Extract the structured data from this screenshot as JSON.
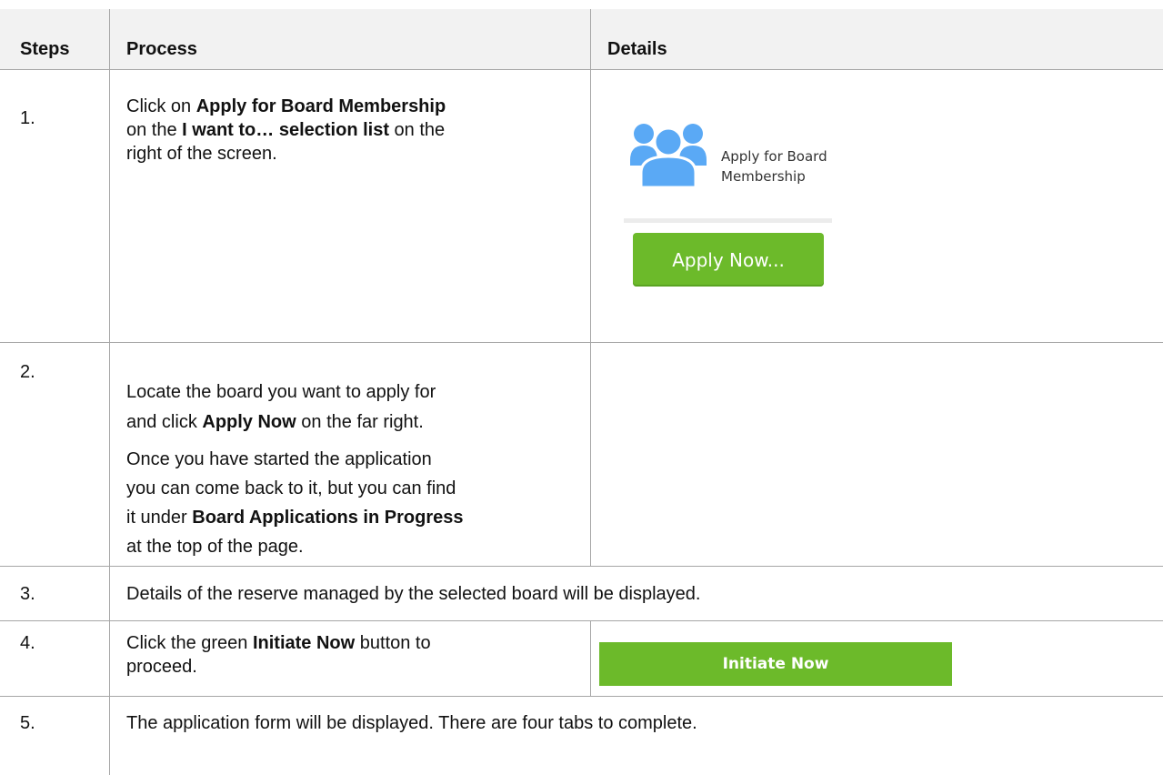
{
  "header": {
    "steps": "Steps",
    "process": "Process",
    "details": "Details"
  },
  "rows": [
    {
      "number": "1.",
      "lines": [
        [
          "Click on ",
          {
            "b": "Apply for Board Membership"
          }
        ],
        [
          "on the ",
          {
            "b": "I want to… selection list"
          },
          " on the"
        ],
        [
          "right of the screen."
        ]
      ],
      "graphic": {
        "icon": "people-group-icon",
        "icon_color": "#5aa9f5",
        "caption_line1": "Apply for Board",
        "caption_line2": "Membership",
        "button_label": "Apply Now...",
        "button_color": "#6cba2a"
      }
    },
    {
      "number": "2.",
      "para1": [
        [
          " Locate the board you want to apply for"
        ],
        [
          " and click ",
          {
            "b": "Apply Now"
          },
          " on the far right."
        ]
      ],
      "para2": [
        [
          "Once you have started the application"
        ],
        [
          "you can come back to it, but you can find"
        ],
        [
          "it under ",
          {
            "b": "Board Applications in Progress"
          }
        ],
        [
          "at the top of the page."
        ]
      ]
    },
    {
      "number": "3.",
      "text": "Details of the reserve managed by the selected board will be displayed."
    },
    {
      "number": "4.",
      "lines": [
        [
          "Click the green ",
          {
            "b": "Initiate Now"
          },
          " button to"
        ],
        [
          "proceed."
        ]
      ],
      "button_label": "Initiate Now",
      "button_color": "#6cba2a"
    },
    {
      "number": "5.",
      "text": "The application form will be displayed. There are four tabs to complete."
    }
  ]
}
